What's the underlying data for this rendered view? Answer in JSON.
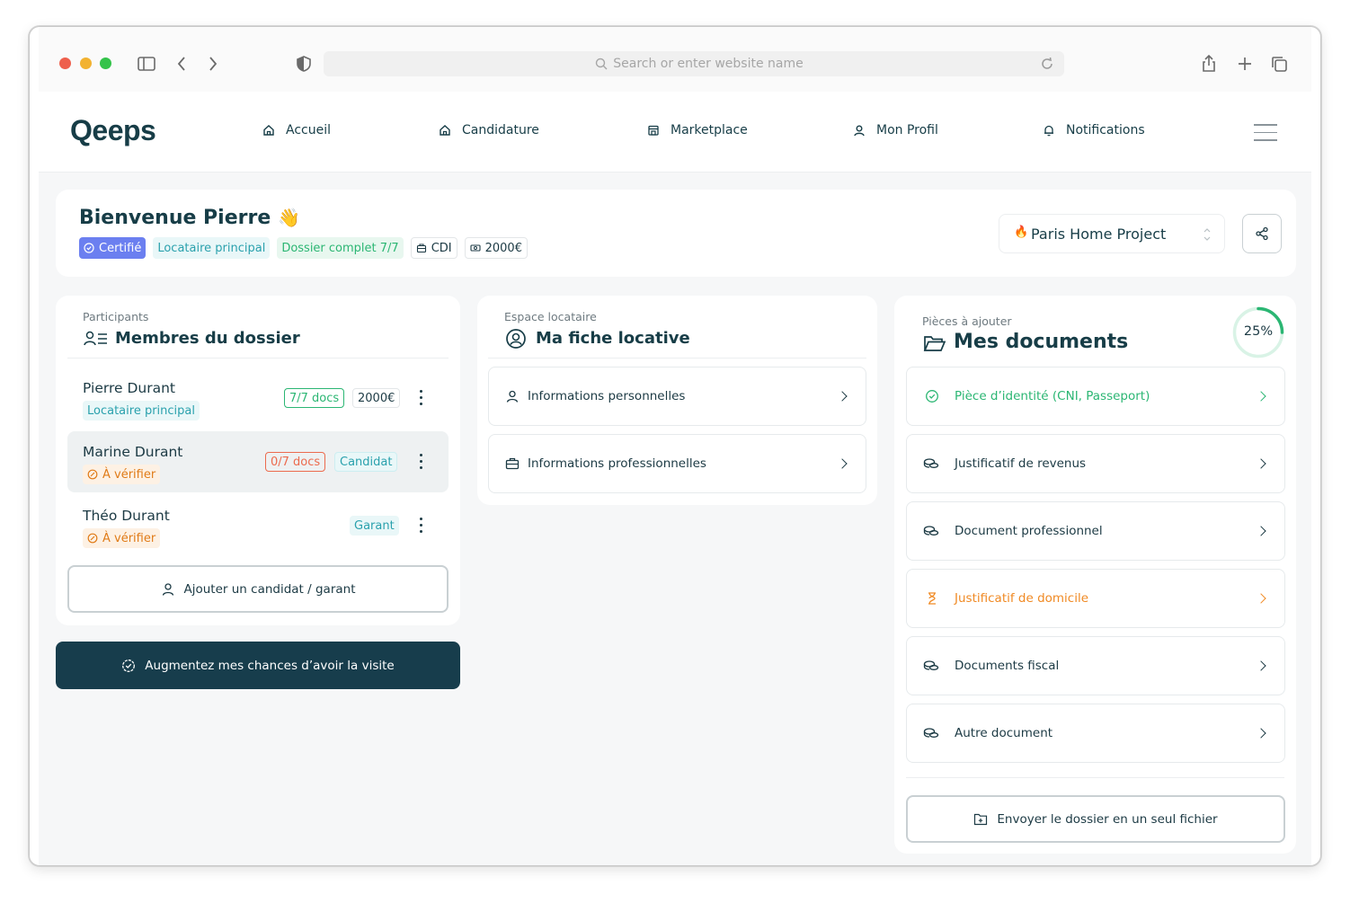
{
  "browser": {
    "url_placeholder": "Search or enter website name",
    "traffic_lights": [
      "#ee5f4c",
      "#f2b230",
      "#34c34a"
    ]
  },
  "nav": {
    "logo": "Qeeps",
    "items": [
      {
        "label": "Accueil",
        "icon": "home-icon"
      },
      {
        "label": "Candidature",
        "icon": "home-icon"
      },
      {
        "label": "Marketplace",
        "icon": "store-icon"
      },
      {
        "label": "Mon Profil",
        "icon": "user-icon"
      },
      {
        "label": "Notifications",
        "icon": "bell-icon"
      }
    ]
  },
  "welcome": {
    "title": "Bienvenue Pierre",
    "emoji": "👋",
    "tags": {
      "certified": "Certifié",
      "role": "Locataire principal",
      "dossier": "Dossier complet 7/7",
      "contract": "CDI",
      "income": "2000€"
    },
    "project": "Paris Home Project"
  },
  "members": {
    "kicker": "Participants",
    "title": "Membres du dossier",
    "people": [
      {
        "name": "Pierre Durant",
        "badge": "Locataire principal",
        "docs": "7/7 docs",
        "amount": "2000€"
      },
      {
        "name": "Marine Durant",
        "badge": "À vérifier",
        "docs": "0/7 docs",
        "role": "Candidat"
      },
      {
        "name": "Théo Durant",
        "badge": "À vérifier",
        "role": "Garant"
      }
    ],
    "add_button": "Ajouter un candidat / garant",
    "cta": "Augmentez mes chances d’avoir la visite"
  },
  "fiche": {
    "kicker": "Espace locataire",
    "title": "Ma fiche locative",
    "rows": [
      "Informations personnelles",
      "Informations professionnelles"
    ]
  },
  "documents": {
    "kicker": "Pièces à ajouter",
    "title": "Mes documents",
    "progress_label": "25%",
    "progress": 0.25,
    "rows": [
      {
        "label": "Pièce d’identité (CNI, Passeport)",
        "status": "done",
        "color": "#2bb673"
      },
      {
        "label": "Justificatif de revenus",
        "status": "todo",
        "color": "#1c3a44"
      },
      {
        "label": "Document professionnel",
        "status": "todo",
        "color": "#1c3a44"
      },
      {
        "label": "Justificatif de domicile",
        "status": "pending",
        "color": "#f08a24"
      },
      {
        "label": "Documents fiscal",
        "status": "todo",
        "color": "#1c3a44"
      },
      {
        "label": "Autre document",
        "status": "todo",
        "color": "#1c3a44"
      }
    ],
    "send_button": "Envoyer le dossier en un seul fichier"
  }
}
